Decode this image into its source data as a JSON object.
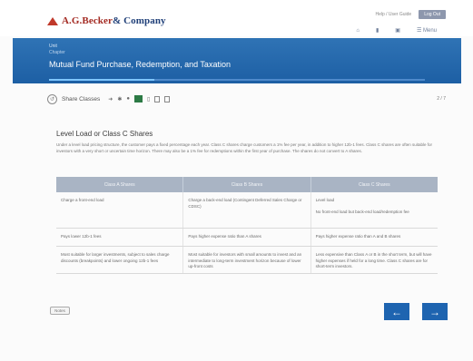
{
  "header": {
    "logo_text_main": "A.G.Becker",
    "logo_text_co": "& Company",
    "help_link": "Help / User Guide",
    "logout_label": "Log Out",
    "icons": [
      "home-icon",
      "bookmark-icon",
      "print-icon",
      "menu-icon"
    ],
    "menu_label": "Menu"
  },
  "banner": {
    "crumb1": "Unit",
    "crumb2": "Chapter",
    "title": "Mutual Fund Purchase, Redemption, and Taxation",
    "progress": 0.28
  },
  "toolbar": {
    "label": "Share Classes",
    "page_count": "2 / 7"
  },
  "section": {
    "title": "Level Load or Class C Shares",
    "intro": "Under a level load pricing structure, the customer pays a fixed percentage each year. Class C shares charge customers a 1% fee per year, in addition to higher 12b-1 fees. Class C shares are often suitable for investors with a very short or uncertain time horizon. There may also be a 1% fee for redemptions within the first year of purchase. The shares do not convert to A shares."
  },
  "table": {
    "headers": [
      "Class A Shares",
      "Class B Shares",
      "Class C Shares"
    ],
    "rows": [
      [
        "Charge a front-end load",
        "Charge a back-end load (Contingent Deferred Sales Charge or CDSC)",
        "Level load\n\nNo front-end load but back-end load/redemption fee"
      ],
      [
        "Pays lower 12b-1 fees",
        "Pays higher expense ratio than A shares",
        "Pays higher expense ratio than A and B shares"
      ],
      [
        "Most suitable for larger investments, subject to sales charge discounts (breakpoints) and lower ongoing 12b-1 fees",
        "Most suitable for investors with small amounts to invest and an intermediate to long-term investment horizon because of lower up-front costs",
        "Less expensive than Class A or B in the short term, but will have higher expenses if held for a long time. Class C shares are for short-term investors."
      ]
    ]
  },
  "footer": {
    "small_button_label": "Notes",
    "prev_icon": "←",
    "next_icon": "→"
  },
  "colors": {
    "banner": "#1d5fa4",
    "table_header": "#a9b4c4",
    "nav_button": "#1e64b0",
    "brand_red": "#a32a22"
  }
}
